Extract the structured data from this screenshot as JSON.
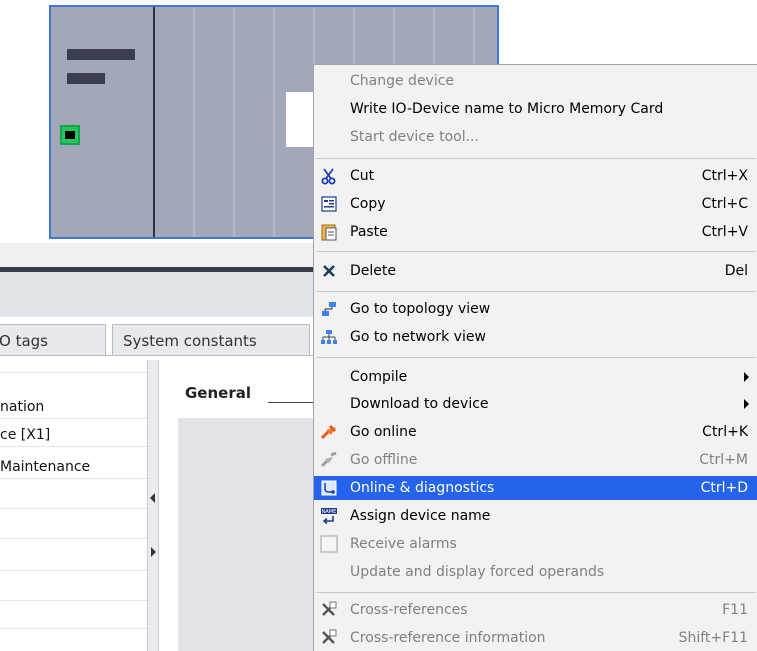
{
  "background": {
    "tabs": [
      "O tags",
      "System constants"
    ],
    "left_items": [
      "nation",
      "ce [X1]",
      "Maintenance"
    ],
    "general_label": "General"
  },
  "menu": {
    "items": [
      {
        "label": "Change device",
        "shortcut": "",
        "disabled": true,
        "icon": ""
      },
      {
        "label": "Write IO-Device name to Micro Memory Card",
        "shortcut": "",
        "disabled": false,
        "icon": ""
      },
      {
        "label": "Start device tool...",
        "shortcut": "",
        "disabled": true,
        "icon": ""
      },
      {
        "label": "Cut",
        "shortcut": "Ctrl+X",
        "disabled": false,
        "icon": "scissors-icon"
      },
      {
        "label": "Copy",
        "shortcut": "Ctrl+C",
        "disabled": false,
        "icon": "copy-icon"
      },
      {
        "label": "Paste",
        "shortcut": "Ctrl+V",
        "disabled": false,
        "icon": "paste-icon"
      },
      {
        "label": "Delete",
        "shortcut": "Del",
        "disabled": false,
        "icon": "delete-x-icon"
      },
      {
        "label": "Go to topology view",
        "shortcut": "",
        "disabled": false,
        "icon": "topology-icon"
      },
      {
        "label": "Go to network view",
        "shortcut": "",
        "disabled": false,
        "icon": "network-icon"
      },
      {
        "label": "Compile",
        "shortcut": "",
        "disabled": false,
        "icon": "",
        "submenu": true
      },
      {
        "label": "Download to device",
        "shortcut": "",
        "disabled": false,
        "icon": "",
        "submenu": true
      },
      {
        "label": "Go online",
        "shortcut": "Ctrl+K",
        "disabled": false,
        "icon": "go-online-icon"
      },
      {
        "label": "Go offline",
        "shortcut": "Ctrl+M",
        "disabled": true,
        "icon": "go-offline-icon"
      },
      {
        "label": "Online & diagnostics",
        "shortcut": "Ctrl+D",
        "disabled": false,
        "highlighted": true,
        "icon": "diagnostics-icon"
      },
      {
        "label": "Assign device name",
        "shortcut": "",
        "disabled": false,
        "icon": "assign-name-icon"
      },
      {
        "label": "Receive alarms",
        "shortcut": "",
        "disabled": true,
        "icon": "checkbox-icon"
      },
      {
        "label": "Update and display forced operands",
        "shortcut": "",
        "disabled": true,
        "icon": ""
      },
      {
        "label": "Cross-references",
        "shortcut": "F11",
        "disabled": true,
        "icon": "cross-reference-icon"
      },
      {
        "label": "Cross-reference information",
        "shortcut": "Shift+F11",
        "disabled": true,
        "icon": "cross-reference-info-icon"
      }
    ]
  },
  "colors": {
    "highlight": "#2563eb",
    "device_border": "#3c78d8",
    "device_body": "#a2a7b9",
    "port_green": "#22c55e"
  }
}
